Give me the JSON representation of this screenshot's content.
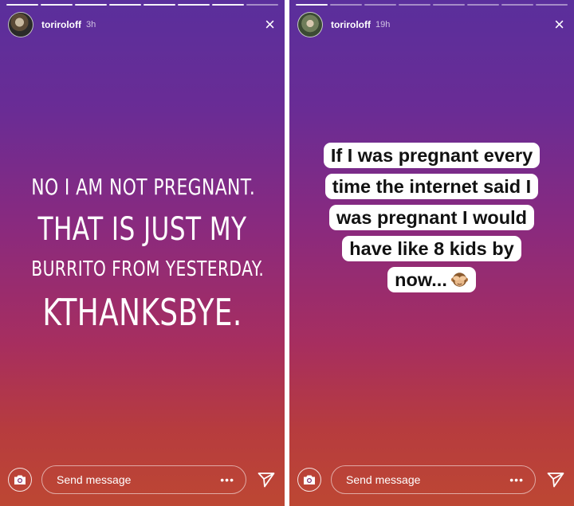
{
  "left_story": {
    "username": "toriroloff",
    "time": "3h",
    "close_label": "×",
    "text": {
      "line1": "NO I AM NOT PREGNANT.",
      "line2": "THAT IS JUST MY",
      "line3": "BURRITO FROM YESTERDAY.",
      "line4": "KTHANKSBYE."
    },
    "footer": {
      "placeholder": "Send message",
      "more_label": "•••"
    }
  },
  "right_story": {
    "username": "toriroloff",
    "time": "19h",
    "close_label": "×",
    "caption_lines": [
      "If I was pregnant every",
      "time the internet said I",
      "was pregnant I would",
      "have like 8 kids by",
      "now..."
    ],
    "emoji_icon": "see-no-evil-monkey-icon",
    "footer": {
      "placeholder": "Send message",
      "more_label": "•••"
    }
  },
  "icons": {
    "camera": "camera-icon",
    "send": "paper-plane-icon",
    "close": "close-icon"
  },
  "colors": {
    "gradient_top": "#5a2f9c",
    "gradient_bottom": "#bd4733",
    "caption_highlight": "#ffffff",
    "text_light": "#ffffff"
  }
}
